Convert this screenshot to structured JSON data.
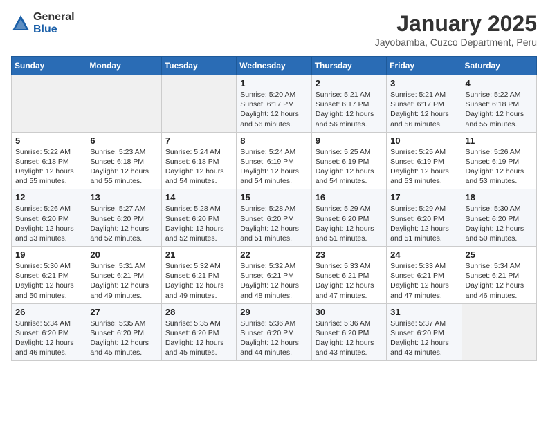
{
  "logo": {
    "general": "General",
    "blue": "Blue"
  },
  "title": "January 2025",
  "location": "Jayobamba, Cuzco Department, Peru",
  "weekdays": [
    "Sunday",
    "Monday",
    "Tuesday",
    "Wednesday",
    "Thursday",
    "Friday",
    "Saturday"
  ],
  "weeks": [
    [
      {
        "day": "",
        "info": ""
      },
      {
        "day": "",
        "info": ""
      },
      {
        "day": "",
        "info": ""
      },
      {
        "day": "1",
        "info": "Sunrise: 5:20 AM\nSunset: 6:17 PM\nDaylight: 12 hours\nand 56 minutes."
      },
      {
        "day": "2",
        "info": "Sunrise: 5:21 AM\nSunset: 6:17 PM\nDaylight: 12 hours\nand 56 minutes."
      },
      {
        "day": "3",
        "info": "Sunrise: 5:21 AM\nSunset: 6:17 PM\nDaylight: 12 hours\nand 56 minutes."
      },
      {
        "day": "4",
        "info": "Sunrise: 5:22 AM\nSunset: 6:18 PM\nDaylight: 12 hours\nand 55 minutes."
      }
    ],
    [
      {
        "day": "5",
        "info": "Sunrise: 5:22 AM\nSunset: 6:18 PM\nDaylight: 12 hours\nand 55 minutes."
      },
      {
        "day": "6",
        "info": "Sunrise: 5:23 AM\nSunset: 6:18 PM\nDaylight: 12 hours\nand 55 minutes."
      },
      {
        "day": "7",
        "info": "Sunrise: 5:24 AM\nSunset: 6:18 PM\nDaylight: 12 hours\nand 54 minutes."
      },
      {
        "day": "8",
        "info": "Sunrise: 5:24 AM\nSunset: 6:19 PM\nDaylight: 12 hours\nand 54 minutes."
      },
      {
        "day": "9",
        "info": "Sunrise: 5:25 AM\nSunset: 6:19 PM\nDaylight: 12 hours\nand 54 minutes."
      },
      {
        "day": "10",
        "info": "Sunrise: 5:25 AM\nSunset: 6:19 PM\nDaylight: 12 hours\nand 53 minutes."
      },
      {
        "day": "11",
        "info": "Sunrise: 5:26 AM\nSunset: 6:19 PM\nDaylight: 12 hours\nand 53 minutes."
      }
    ],
    [
      {
        "day": "12",
        "info": "Sunrise: 5:26 AM\nSunset: 6:20 PM\nDaylight: 12 hours\nand 53 minutes."
      },
      {
        "day": "13",
        "info": "Sunrise: 5:27 AM\nSunset: 6:20 PM\nDaylight: 12 hours\nand 52 minutes."
      },
      {
        "day": "14",
        "info": "Sunrise: 5:28 AM\nSunset: 6:20 PM\nDaylight: 12 hours\nand 52 minutes."
      },
      {
        "day": "15",
        "info": "Sunrise: 5:28 AM\nSunset: 6:20 PM\nDaylight: 12 hours\nand 51 minutes."
      },
      {
        "day": "16",
        "info": "Sunrise: 5:29 AM\nSunset: 6:20 PM\nDaylight: 12 hours\nand 51 minutes."
      },
      {
        "day": "17",
        "info": "Sunrise: 5:29 AM\nSunset: 6:20 PM\nDaylight: 12 hours\nand 51 minutes."
      },
      {
        "day": "18",
        "info": "Sunrise: 5:30 AM\nSunset: 6:20 PM\nDaylight: 12 hours\nand 50 minutes."
      }
    ],
    [
      {
        "day": "19",
        "info": "Sunrise: 5:30 AM\nSunset: 6:21 PM\nDaylight: 12 hours\nand 50 minutes."
      },
      {
        "day": "20",
        "info": "Sunrise: 5:31 AM\nSunset: 6:21 PM\nDaylight: 12 hours\nand 49 minutes."
      },
      {
        "day": "21",
        "info": "Sunrise: 5:32 AM\nSunset: 6:21 PM\nDaylight: 12 hours\nand 49 minutes."
      },
      {
        "day": "22",
        "info": "Sunrise: 5:32 AM\nSunset: 6:21 PM\nDaylight: 12 hours\nand 48 minutes."
      },
      {
        "day": "23",
        "info": "Sunrise: 5:33 AM\nSunset: 6:21 PM\nDaylight: 12 hours\nand 47 minutes."
      },
      {
        "day": "24",
        "info": "Sunrise: 5:33 AM\nSunset: 6:21 PM\nDaylight: 12 hours\nand 47 minutes."
      },
      {
        "day": "25",
        "info": "Sunrise: 5:34 AM\nSunset: 6:21 PM\nDaylight: 12 hours\nand 46 minutes."
      }
    ],
    [
      {
        "day": "26",
        "info": "Sunrise: 5:34 AM\nSunset: 6:20 PM\nDaylight: 12 hours\nand 46 minutes."
      },
      {
        "day": "27",
        "info": "Sunrise: 5:35 AM\nSunset: 6:20 PM\nDaylight: 12 hours\nand 45 minutes."
      },
      {
        "day": "28",
        "info": "Sunrise: 5:35 AM\nSunset: 6:20 PM\nDaylight: 12 hours\nand 45 minutes."
      },
      {
        "day": "29",
        "info": "Sunrise: 5:36 AM\nSunset: 6:20 PM\nDaylight: 12 hours\nand 44 minutes."
      },
      {
        "day": "30",
        "info": "Sunrise: 5:36 AM\nSunset: 6:20 PM\nDaylight: 12 hours\nand 43 minutes."
      },
      {
        "day": "31",
        "info": "Sunrise: 5:37 AM\nSunset: 6:20 PM\nDaylight: 12 hours\nand 43 minutes."
      },
      {
        "day": "",
        "info": ""
      }
    ]
  ]
}
